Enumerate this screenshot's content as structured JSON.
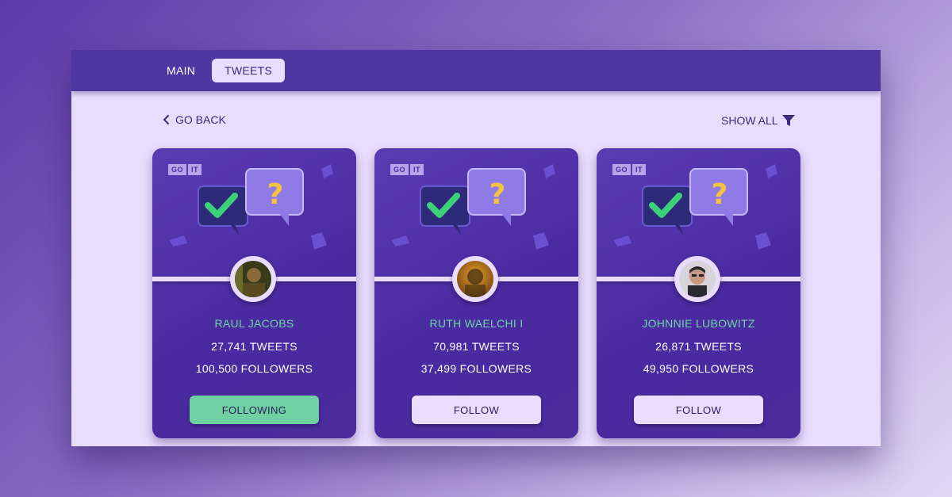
{
  "nav": {
    "tabs": [
      {
        "label": "MAIN",
        "active": false
      },
      {
        "label": "TWEETS",
        "active": true
      }
    ]
  },
  "toolbar": {
    "back_label": "GO BACK",
    "show_all_label": "SHOW ALL"
  },
  "logo": {
    "part1": "GO",
    "part2": "IT"
  },
  "cards": [
    {
      "name": "RAUL JACOBS",
      "tweets": "27,741 TWEETS",
      "followers": "100,500 FOLLOWERS",
      "button": "FOLLOWING",
      "following": true
    },
    {
      "name": "RUTH WAELCHI I",
      "tweets": "70,981 TWEETS",
      "followers": "37,499 FOLLOWERS",
      "button": "FOLLOW",
      "following": false
    },
    {
      "name": "JOHNNIE LUBOWITZ",
      "tweets": "26,871 TWEETS",
      "followers": "49,950 FOLLOWERS",
      "button": "FOLLOW",
      "following": false
    }
  ],
  "colors": {
    "accent": "#4f36a0",
    "background": "#e9dcfd",
    "name_green": "#6fd6a8",
    "following_button": "#6fd1a2"
  },
  "icons": {
    "back": "chevron-left-icon",
    "filter": "filter-icon",
    "hero": "check-and-question-bubbles-icon"
  }
}
